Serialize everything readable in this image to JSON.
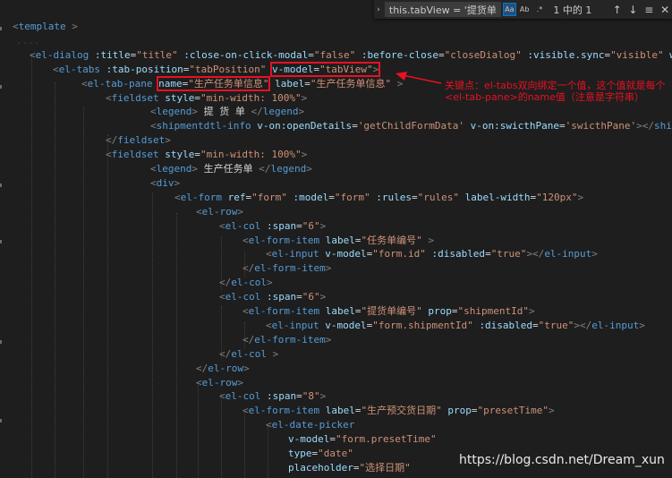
{
  "find_widget": {
    "toggle_icon": "chevron-right-icon",
    "query": "this.tabView = '提货单信...",
    "match_case": "Aa",
    "whole_word": "Ab",
    "regex": ".*",
    "count": "1 中的 1",
    "prev_icon": "arrow-up-icon",
    "next_icon": "arrow-down-icon",
    "selection_icon": "find-in-selection-icon",
    "close_icon": "close-icon"
  },
  "code_lines": [
    [
      [
        "p",
        "<"
      ],
      [
        "t",
        "template"
      ],
      [
        "p",
        " >"
      ]
    ],
    [
      [
        "g",
        "...."
      ]
    ],
    [
      [
        "p",
        "<"
      ],
      [
        "t",
        "el-dialog"
      ],
      [
        "x",
        " "
      ],
      [
        "a",
        ":title"
      ],
      [
        "x",
        "="
      ],
      [
        "s",
        "\"title\""
      ],
      [
        "x",
        " "
      ],
      [
        "a",
        ":close-on-click-modal"
      ],
      [
        "x",
        "="
      ],
      [
        "s",
        "\"false\""
      ],
      [
        "x",
        " "
      ],
      [
        "a",
        ":before-close"
      ],
      [
        "x",
        "="
      ],
      [
        "s",
        "\"closeDialog\""
      ],
      [
        "x",
        " "
      ],
      [
        "a",
        ":visible.sync"
      ],
      [
        "x",
        "="
      ],
      [
        "s",
        "\"visible\""
      ],
      [
        "x",
        " "
      ],
      [
        "a",
        "widt"
      ]
    ],
    [
      [
        "p",
        "<"
      ],
      [
        "t",
        "el-tabs"
      ],
      [
        "x",
        " "
      ],
      [
        "a",
        ":tab-position"
      ],
      [
        "x",
        "="
      ],
      [
        "s",
        "\"tabPosition\""
      ],
      [
        "x",
        " "
      ],
      [
        "a",
        "v-model"
      ],
      [
        "x",
        "="
      ],
      [
        "s",
        "\"tabView\""
      ],
      [
        "p",
        ">"
      ]
    ],
    [
      [
        "p",
        "<"
      ],
      [
        "t",
        "el-tab-pane"
      ],
      [
        "x",
        " "
      ],
      [
        "a",
        "name"
      ],
      [
        "x",
        "="
      ],
      [
        "s",
        "\"生产任务单信息\""
      ],
      [
        "x",
        " "
      ],
      [
        "a",
        "label"
      ],
      [
        "x",
        "="
      ],
      [
        "s",
        "\"生产任务单信息\""
      ],
      [
        "x",
        " "
      ],
      [
        "p",
        ">"
      ]
    ],
    [
      [
        "p",
        "<"
      ],
      [
        "t",
        "fieldset"
      ],
      [
        "x",
        " "
      ],
      [
        "a",
        "style"
      ],
      [
        "x",
        "="
      ],
      [
        "s",
        "\"min-width: 100%\""
      ],
      [
        "p",
        ">"
      ]
    ],
    [
      [
        "p",
        "<"
      ],
      [
        "t",
        "legend"
      ],
      [
        "p",
        ">"
      ],
      [
        "x",
        " 提 货 单 "
      ],
      [
        "p",
        "</"
      ],
      [
        "t",
        "legend"
      ],
      [
        "p",
        ">"
      ]
    ],
    [
      [
        "p",
        "<"
      ],
      [
        "t",
        "shipmentdtl-info"
      ],
      [
        "x",
        " "
      ],
      [
        "a",
        "v-on:openDetails"
      ],
      [
        "x",
        "="
      ],
      [
        "s",
        "'getChildFormData'"
      ],
      [
        "x",
        " "
      ],
      [
        "a",
        "v-on:swicthPane"
      ],
      [
        "x",
        "="
      ],
      [
        "s",
        "'swicthPane'"
      ],
      [
        "p",
        "></"
      ],
      [
        "t",
        "shipme"
      ]
    ],
    [
      [
        "p",
        "</"
      ],
      [
        "t",
        "fieldset"
      ],
      [
        "p",
        ">"
      ]
    ],
    [
      [
        "p",
        "<"
      ],
      [
        "t",
        "fieldset"
      ],
      [
        "x",
        " "
      ],
      [
        "a",
        "style"
      ],
      [
        "x",
        "="
      ],
      [
        "s",
        "\"min-width: 100%\""
      ],
      [
        "p",
        ">"
      ]
    ],
    [
      [
        "p",
        "<"
      ],
      [
        "t",
        "legend"
      ],
      [
        "p",
        ">"
      ],
      [
        "x",
        " 生产任务单 "
      ],
      [
        "p",
        "</"
      ],
      [
        "t",
        "legend"
      ],
      [
        "p",
        ">"
      ]
    ],
    [
      [
        "p",
        "<"
      ],
      [
        "t",
        "div"
      ],
      [
        "p",
        ">"
      ]
    ],
    [
      [
        "p",
        "<"
      ],
      [
        "t",
        "el-form"
      ],
      [
        "x",
        " "
      ],
      [
        "a",
        "ref"
      ],
      [
        "x",
        "="
      ],
      [
        "s",
        "\"form\""
      ],
      [
        "x",
        " "
      ],
      [
        "a",
        ":model"
      ],
      [
        "x",
        "="
      ],
      [
        "s",
        "\"form\""
      ],
      [
        "x",
        " "
      ],
      [
        "a",
        ":rules"
      ],
      [
        "x",
        "="
      ],
      [
        "s",
        "\"rules\""
      ],
      [
        "x",
        " "
      ],
      [
        "a",
        "label-width"
      ],
      [
        "x",
        "="
      ],
      [
        "s",
        "\"120px\""
      ],
      [
        "p",
        ">"
      ]
    ],
    [
      [
        "p",
        "<"
      ],
      [
        "t",
        "el-row"
      ],
      [
        "p",
        ">"
      ]
    ],
    [
      [
        "p",
        "<"
      ],
      [
        "t",
        "el-col"
      ],
      [
        "x",
        " "
      ],
      [
        "a",
        ":span"
      ],
      [
        "x",
        "="
      ],
      [
        "s",
        "\"6\""
      ],
      [
        "p",
        ">"
      ]
    ],
    [
      [
        "p",
        "<"
      ],
      [
        "t",
        "el-form-item"
      ],
      [
        "x",
        " "
      ],
      [
        "a",
        "label"
      ],
      [
        "x",
        "="
      ],
      [
        "s",
        "\"任务单编号\""
      ],
      [
        "x",
        " "
      ],
      [
        "p",
        ">"
      ]
    ],
    [
      [
        "p",
        "<"
      ],
      [
        "t",
        "el-input"
      ],
      [
        "x",
        " "
      ],
      [
        "a",
        "v-model"
      ],
      [
        "x",
        "="
      ],
      [
        "s",
        "\"form.id\""
      ],
      [
        "x",
        " "
      ],
      [
        "a",
        ":disabled"
      ],
      [
        "x",
        "="
      ],
      [
        "s",
        "\"true\""
      ],
      [
        "p",
        "></"
      ],
      [
        "t",
        "el-input"
      ],
      [
        "p",
        ">"
      ]
    ],
    [
      [
        "p",
        "</"
      ],
      [
        "t",
        "el-form-item"
      ],
      [
        "p",
        ">"
      ]
    ],
    [
      [
        "p",
        "</"
      ],
      [
        "t",
        "el-col"
      ],
      [
        "p",
        ">"
      ]
    ],
    [
      [
        "p",
        "<"
      ],
      [
        "t",
        "el-col"
      ],
      [
        "x",
        " "
      ],
      [
        "a",
        ":span"
      ],
      [
        "x",
        "="
      ],
      [
        "s",
        "\"6\""
      ],
      [
        "p",
        ">"
      ]
    ],
    [
      [
        "p",
        "<"
      ],
      [
        "t",
        "el-form-item"
      ],
      [
        "x",
        " "
      ],
      [
        "a",
        "label"
      ],
      [
        "x",
        "="
      ],
      [
        "s",
        "\"提货单编号\""
      ],
      [
        "x",
        " "
      ],
      [
        "a",
        "prop"
      ],
      [
        "x",
        "="
      ],
      [
        "s",
        "\"shipmentId\""
      ],
      [
        "p",
        ">"
      ]
    ],
    [
      [
        "p",
        "<"
      ],
      [
        "t",
        "el-input"
      ],
      [
        "x",
        " "
      ],
      [
        "a",
        "v-model"
      ],
      [
        "x",
        "="
      ],
      [
        "s",
        "\"form.shipmentId\""
      ],
      [
        "x",
        " "
      ],
      [
        "a",
        ":disabled"
      ],
      [
        "x",
        "="
      ],
      [
        "s",
        "\"true\""
      ],
      [
        "p",
        "></"
      ],
      [
        "t",
        "el-input"
      ],
      [
        "p",
        ">"
      ]
    ],
    [
      [
        "p",
        "</"
      ],
      [
        "t",
        "el-form-item"
      ],
      [
        "p",
        ">"
      ]
    ],
    [
      [
        "p",
        "</"
      ],
      [
        "t",
        "el-col"
      ],
      [
        "x",
        " "
      ],
      [
        "p",
        ">"
      ]
    ],
    [
      [
        "p",
        "</"
      ],
      [
        "t",
        "el-row"
      ],
      [
        "p",
        ">"
      ]
    ],
    [
      [
        "p",
        "<"
      ],
      [
        "t",
        "el-row"
      ],
      [
        "p",
        ">"
      ]
    ],
    [
      [
        "p",
        "<"
      ],
      [
        "t",
        "el-col"
      ],
      [
        "x",
        " "
      ],
      [
        "a",
        ":span"
      ],
      [
        "x",
        "="
      ],
      [
        "s",
        "\"8\""
      ],
      [
        "p",
        ">"
      ]
    ],
    [
      [
        "p",
        "<"
      ],
      [
        "t",
        "el-form-item"
      ],
      [
        "x",
        " "
      ],
      [
        "a",
        "label"
      ],
      [
        "x",
        "="
      ],
      [
        "s",
        "\"生产预交货日期\""
      ],
      [
        "x",
        " "
      ],
      [
        "a",
        "prop"
      ],
      [
        "x",
        "="
      ],
      [
        "s",
        "\"presetTime\""
      ],
      [
        "p",
        ">"
      ]
    ],
    [
      [
        "p",
        "<"
      ],
      [
        "t",
        "el-date-picker"
      ]
    ],
    [
      [
        "a",
        "v-model"
      ],
      [
        "x",
        "="
      ],
      [
        "s",
        "\"form.presetTime\""
      ]
    ],
    [
      [
        "a",
        "type"
      ],
      [
        "x",
        "="
      ],
      [
        "s",
        "\"date\""
      ]
    ],
    [
      [
        "a",
        "placeholder"
      ],
      [
        "x",
        "="
      ],
      [
        "s",
        "\"选择日期\""
      ]
    ]
  ],
  "annotation": "关键点：el-tabs双向绑定一个值，这个值就是每个<el-tab-pane>的name值（注意是字符串）",
  "watermark": "https://blog.csdn.net/Dream_xun"
}
